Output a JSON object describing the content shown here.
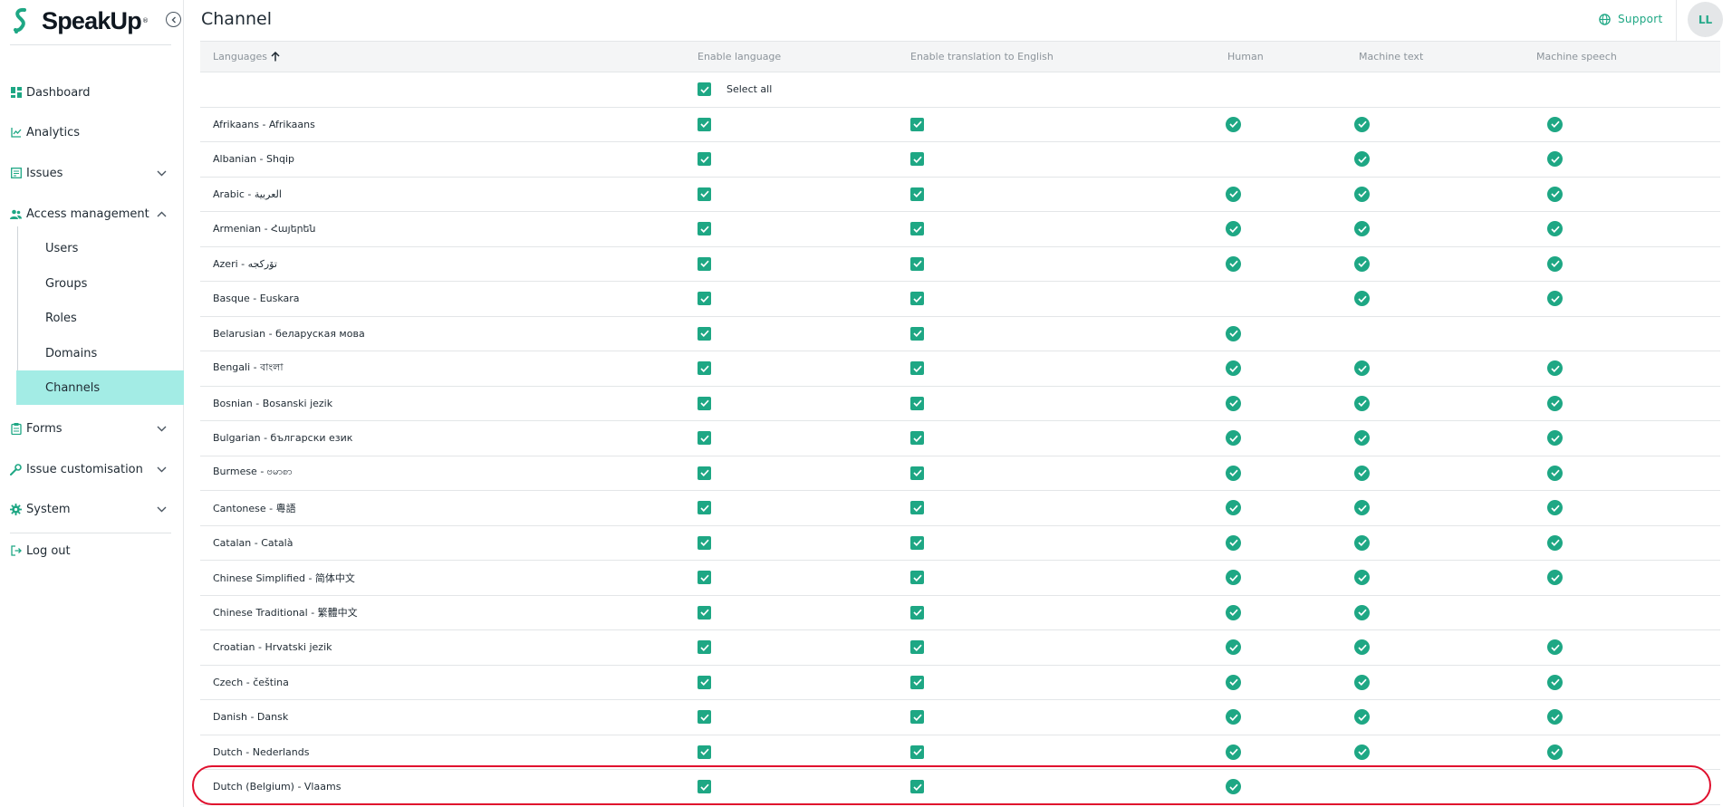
{
  "app": {
    "brand": "SpeakUp",
    "trademark": "®"
  },
  "header": {
    "title": "Channel",
    "support_label": "Support",
    "avatar_initials": "LL"
  },
  "sidebar": {
    "items": [
      {
        "label": "Dashboard",
        "icon": "dashboard-icon"
      },
      {
        "label": "Analytics",
        "icon": "analytics-icon"
      },
      {
        "label": "Issues",
        "icon": "issues-icon",
        "expandable": true,
        "expanded": false
      },
      {
        "label": "Access management",
        "icon": "access-management-icon",
        "expandable": true,
        "expanded": true
      },
      {
        "label": "Forms",
        "icon": "forms-icon",
        "expandable": true,
        "expanded": false
      },
      {
        "label": "Issue customisation",
        "icon": "issue-customisation-icon",
        "expandable": true,
        "expanded": false
      },
      {
        "label": "System",
        "icon": "system-icon",
        "expandable": true,
        "expanded": false
      }
    ],
    "access_sub_items": [
      "Users",
      "Groups",
      "Roles",
      "Domains",
      "Channels"
    ],
    "active_sub_item": "Channels",
    "logout_label": "Log out"
  },
  "colors": {
    "accent": "#1ea784",
    "active_bg": "#a3ece5",
    "highlight": "#e0102e"
  },
  "table": {
    "columns": [
      "Languages",
      "Enable language",
      "Enable translation to English",
      "Human",
      "Machine text",
      "Machine speech"
    ],
    "sort": {
      "column": "Languages",
      "direction": "ascending"
    },
    "select_all_label": "Select all",
    "rows": [
      {
        "language": "Afrikaans - Afrikaans",
        "enabled": true,
        "translate": true,
        "human": true,
        "machine_text": true,
        "machine_speech": true
      },
      {
        "language": "Albanian - Shqip",
        "enabled": true,
        "translate": true,
        "human": false,
        "machine_text": true,
        "machine_speech": true
      },
      {
        "language": "Arabic - العربية",
        "enabled": true,
        "translate": true,
        "human": true,
        "machine_text": true,
        "machine_speech": true
      },
      {
        "language": "Armenian - Հայերեն",
        "enabled": true,
        "translate": true,
        "human": true,
        "machine_text": true,
        "machine_speech": true
      },
      {
        "language": "Azeri - تۆرکجه",
        "enabled": true,
        "translate": true,
        "human": true,
        "machine_text": true,
        "machine_speech": true
      },
      {
        "language": "Basque - Euskara",
        "enabled": true,
        "translate": true,
        "human": false,
        "machine_text": true,
        "machine_speech": true
      },
      {
        "language": "Belarusian - беларуская мова",
        "enabled": true,
        "translate": true,
        "human": true,
        "machine_text": false,
        "machine_speech": false
      },
      {
        "language": "Bengali - বাংলা",
        "enabled": true,
        "translate": true,
        "human": true,
        "machine_text": true,
        "machine_speech": true
      },
      {
        "language": "Bosnian - Bosanski jezik",
        "enabled": true,
        "translate": true,
        "human": true,
        "machine_text": true,
        "machine_speech": true
      },
      {
        "language": "Bulgarian - български език",
        "enabled": true,
        "translate": true,
        "human": true,
        "machine_text": true,
        "machine_speech": true
      },
      {
        "language": "Burmese - ဗမာစာ",
        "enabled": true,
        "translate": true,
        "human": true,
        "machine_text": true,
        "machine_speech": true
      },
      {
        "language": "Cantonese - 粵語",
        "enabled": true,
        "translate": true,
        "human": true,
        "machine_text": true,
        "machine_speech": true
      },
      {
        "language": "Catalan - Català",
        "enabled": true,
        "translate": true,
        "human": true,
        "machine_text": true,
        "machine_speech": true
      },
      {
        "language": "Chinese Simplified - 简体中文",
        "enabled": true,
        "translate": true,
        "human": true,
        "machine_text": true,
        "machine_speech": true
      },
      {
        "language": "Chinese Traditional - 繁體中文",
        "enabled": true,
        "translate": true,
        "human": true,
        "machine_text": true,
        "machine_speech": false
      },
      {
        "language": "Croatian - Hrvatski jezik",
        "enabled": true,
        "translate": true,
        "human": true,
        "machine_text": true,
        "machine_speech": true
      },
      {
        "language": "Czech - čeština",
        "enabled": true,
        "translate": true,
        "human": true,
        "machine_text": true,
        "machine_speech": true
      },
      {
        "language": "Danish - Dansk",
        "enabled": true,
        "translate": true,
        "human": true,
        "machine_text": true,
        "machine_speech": true
      },
      {
        "language": "Dutch - Nederlands",
        "enabled": true,
        "translate": true,
        "human": true,
        "machine_text": true,
        "machine_speech": true
      },
      {
        "language": "Dutch (Belgium) - Vlaams",
        "enabled": true,
        "translate": true,
        "human": true,
        "machine_text": false,
        "machine_speech": false,
        "highlighted": true
      }
    ]
  }
}
